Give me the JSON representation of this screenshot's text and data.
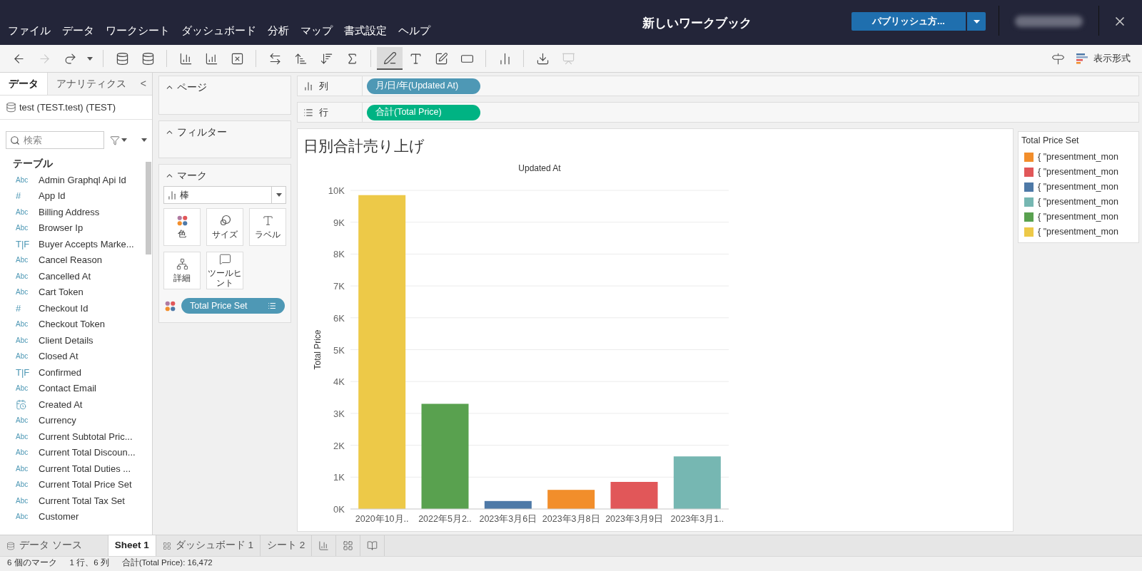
{
  "window": {
    "title": "新しいワークブック"
  },
  "menubar": {
    "items": [
      "ファイル",
      "データ",
      "ワークシート",
      "ダッシュボード",
      "分析",
      "マップ",
      "書式設定",
      "ヘルプ"
    ]
  },
  "publish_button": {
    "label": "パブリッシュ方..."
  },
  "toolbar": {
    "buttons": [
      {
        "kind": "back",
        "disabled": false,
        "selected": false
      },
      {
        "kind": "forward",
        "disabled": true,
        "selected": false
      },
      {
        "kind": "redo",
        "disabled": false,
        "selected": false
      },
      {
        "kind": "caret",
        "disabled": false,
        "selected": false
      },
      {
        "kind": "sep"
      },
      {
        "kind": "database",
        "disabled": false,
        "selected": false
      },
      {
        "kind": "database",
        "disabled": false,
        "selected": false
      },
      {
        "kind": "sep"
      },
      {
        "kind": "new-chart",
        "disabled": false,
        "selected": false
      },
      {
        "kind": "chart",
        "disabled": false,
        "selected": false
      },
      {
        "kind": "clear",
        "disabled": false,
        "selected": false
      },
      {
        "kind": "sep"
      },
      {
        "kind": "swap",
        "disabled": false,
        "selected": false
      },
      {
        "kind": "sort-asc",
        "disabled": false,
        "selected": false
      },
      {
        "kind": "sort-desc",
        "disabled": false,
        "selected": false
      },
      {
        "kind": "sigma",
        "disabled": false,
        "selected": false
      },
      {
        "kind": "sep"
      },
      {
        "kind": "pen",
        "disabled": false,
        "selected": true
      },
      {
        "kind": "text",
        "disabled": false,
        "selected": false
      },
      {
        "kind": "edit",
        "disabled": false,
        "selected": false
      },
      {
        "kind": "frame",
        "disabled": false,
        "selected": false
      },
      {
        "kind": "sep"
      },
      {
        "kind": "show-me",
        "disabled": false,
        "selected": false
      },
      {
        "kind": "sep"
      },
      {
        "kind": "download",
        "disabled": false,
        "selected": false
      },
      {
        "kind": "present",
        "disabled": true,
        "selected": false
      }
    ],
    "format_button": {
      "label": "表示形式"
    }
  },
  "data_pane": {
    "tabs": [
      {
        "label": "データ",
        "selected": true
      },
      {
        "label": "アナリティクス",
        "selected": false
      }
    ],
    "collapse": "<",
    "datasource": "test (TEST.test) (TEST)",
    "search": {
      "placeholder": "検索"
    },
    "section_title": "テーブル",
    "fields": [
      {
        "kind": "text",
        "type_label": "Abc",
        "name": "Admin Graphql Api Id"
      },
      {
        "kind": "number",
        "type_label": "#",
        "name": "App Id"
      },
      {
        "kind": "text",
        "type_label": "Abc",
        "name": "Billing Address"
      },
      {
        "kind": "text",
        "type_label": "Abc",
        "name": "Browser Ip"
      },
      {
        "kind": "boolean",
        "type_label": "T|F",
        "name": "Buyer Accepts Marke..."
      },
      {
        "kind": "text",
        "type_label": "Abc",
        "name": "Cancel Reason"
      },
      {
        "kind": "text",
        "type_label": "Abc",
        "name": "Cancelled At"
      },
      {
        "kind": "text",
        "type_label": "Abc",
        "name": "Cart Token"
      },
      {
        "kind": "number",
        "type_label": "#",
        "name": "Checkout Id"
      },
      {
        "kind": "text",
        "type_label": "Abc",
        "name": "Checkout Token"
      },
      {
        "kind": "text",
        "type_label": "Abc",
        "name": "Client Details"
      },
      {
        "kind": "text",
        "type_label": "Abc",
        "name": "Closed At"
      },
      {
        "kind": "boolean",
        "type_label": "T|F",
        "name": "Confirmed"
      },
      {
        "kind": "text",
        "type_label": "Abc",
        "name": "Contact Email"
      },
      {
        "kind": "date",
        "name": "Created At"
      },
      {
        "kind": "text",
        "type_label": "Abc",
        "name": "Currency"
      },
      {
        "kind": "text",
        "type_label": "Abc",
        "name": "Current Subtotal Pric..."
      },
      {
        "kind": "text",
        "type_label": "Abc",
        "name": "Current Total Discoun..."
      },
      {
        "kind": "text",
        "type_label": "Abc",
        "name": "Current Total Duties ..."
      },
      {
        "kind": "text",
        "type_label": "Abc",
        "name": "Current Total Price Set"
      },
      {
        "kind": "text",
        "type_label": "Abc",
        "name": "Current Total Tax Set"
      },
      {
        "kind": "text",
        "type_label": "Abc",
        "name": "Customer"
      }
    ]
  },
  "cards": {
    "pages": {
      "title": "ページ"
    },
    "filters": {
      "title": "フィルター"
    },
    "marks": {
      "title": "マーク",
      "mark_type": "棒",
      "buttons": [
        {
          "kind": "color",
          "label": "色"
        },
        {
          "kind": "size",
          "label": "サイズ"
        },
        {
          "kind": "label",
          "label": "ラベル"
        },
        {
          "kind": "detail",
          "label": "詳細"
        },
        {
          "kind": "tooltip",
          "label": "ツールヒント"
        }
      ],
      "pill": {
        "label": "Total Price Set"
      }
    }
  },
  "shelves": [
    {
      "kind": "columns",
      "label": "列",
      "pill": {
        "label": "月/日/年(Updated At)",
        "color": "#4e98b5"
      }
    },
    {
      "kind": "rows",
      "label": "行",
      "pill": {
        "label": "合計(Total Price)",
        "color": "#00b383"
      }
    }
  ],
  "sheet": {
    "title": "日別合計売り上げ",
    "chart_data": {
      "type": "bar",
      "title": "Updated At",
      "ylabel": "Total Price",
      "categories": [
        "2020年10月..",
        "2022年5月2..",
        "2023年3月6日",
        "2023年3月8日",
        "2023年3月9日",
        "2023年3月1.."
      ],
      "values": [
        9850,
        3300,
        250,
        600,
        850,
        1650
      ],
      "colors": [
        "#edc948",
        "#59a14f",
        "#4e79a7",
        "#f28e2b",
        "#e15759",
        "#76b7b2"
      ],
      "ylim": [
        0,
        10000
      ],
      "grid": true,
      "yticks": [
        {
          "value": 0,
          "label": "0K"
        },
        {
          "value": 1000,
          "label": "1K"
        },
        {
          "value": 2000,
          "label": "2K"
        },
        {
          "value": 3000,
          "label": "3K"
        },
        {
          "value": 4000,
          "label": "4K"
        },
        {
          "value": 5000,
          "label": "5K"
        },
        {
          "value": 6000,
          "label": "6K"
        },
        {
          "value": 7000,
          "label": "7K"
        },
        {
          "value": 8000,
          "label": "8K"
        },
        {
          "value": 9000,
          "label": "9K"
        },
        {
          "value": 10000,
          "label": "10K"
        }
      ]
    }
  },
  "legend": {
    "title": "Total Price Set",
    "items": [
      {
        "label": "{ \"presentment_mon",
        "color": "#f28e2b"
      },
      {
        "label": "{ \"presentment_mon",
        "color": "#e15759"
      },
      {
        "label": "{ \"presentment_mon",
        "color": "#4e79a7"
      },
      {
        "label": "{ \"presentment_mon",
        "color": "#76b7b2"
      },
      {
        "label": "{ \"presentment_mon",
        "color": "#59a14f"
      },
      {
        "label": "{ \"presentment_mon",
        "color": "#edc948"
      }
    ]
  },
  "sheet_tabs": [
    {
      "kind": "datasource",
      "label": "データ ソース",
      "selected": false
    },
    {
      "kind": "sheet",
      "label": "Sheet 1",
      "selected": true
    },
    {
      "kind": "dashboard",
      "label": "ダッシュボード 1",
      "selected": false
    },
    {
      "kind": "sheet",
      "label": "シート 2",
      "selected": false
    },
    {
      "kind": "new-sheet"
    },
    {
      "kind": "new-dashboard"
    },
    {
      "kind": "new-story"
    }
  ],
  "status_bar": [
    "6 個のマーク",
    "1 行、6 列",
    "合計(Total Price): 16,472"
  ]
}
